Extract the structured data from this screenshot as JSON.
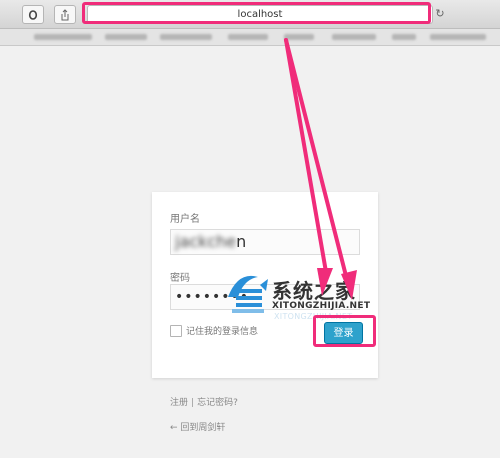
{
  "browser": {
    "url": "localhost",
    "reload_glyph": "↻",
    "toolbar_icons": [
      "opera-icon",
      "share-icon"
    ]
  },
  "login": {
    "username_label": "用户名",
    "username_value": "jackchen",
    "password_label": "密码",
    "password_value": "••••••••",
    "remember_label": "记住我的登录信息",
    "login_button": "登录"
  },
  "links": {
    "register": "注册",
    "separator": "|",
    "forgot": "忘记密码?",
    "back": "← 回到周剑轩"
  },
  "watermark": {
    "brand_cn": "系统之家",
    "brand_en": "XITONGZHIJIA.NET",
    "brand_ghost": "XITONGZHIJIA.NET"
  },
  "colors": {
    "highlight": "#f02c7a",
    "button": "#2ea2cc",
    "watermark_blue": "#2a8fd8"
  }
}
